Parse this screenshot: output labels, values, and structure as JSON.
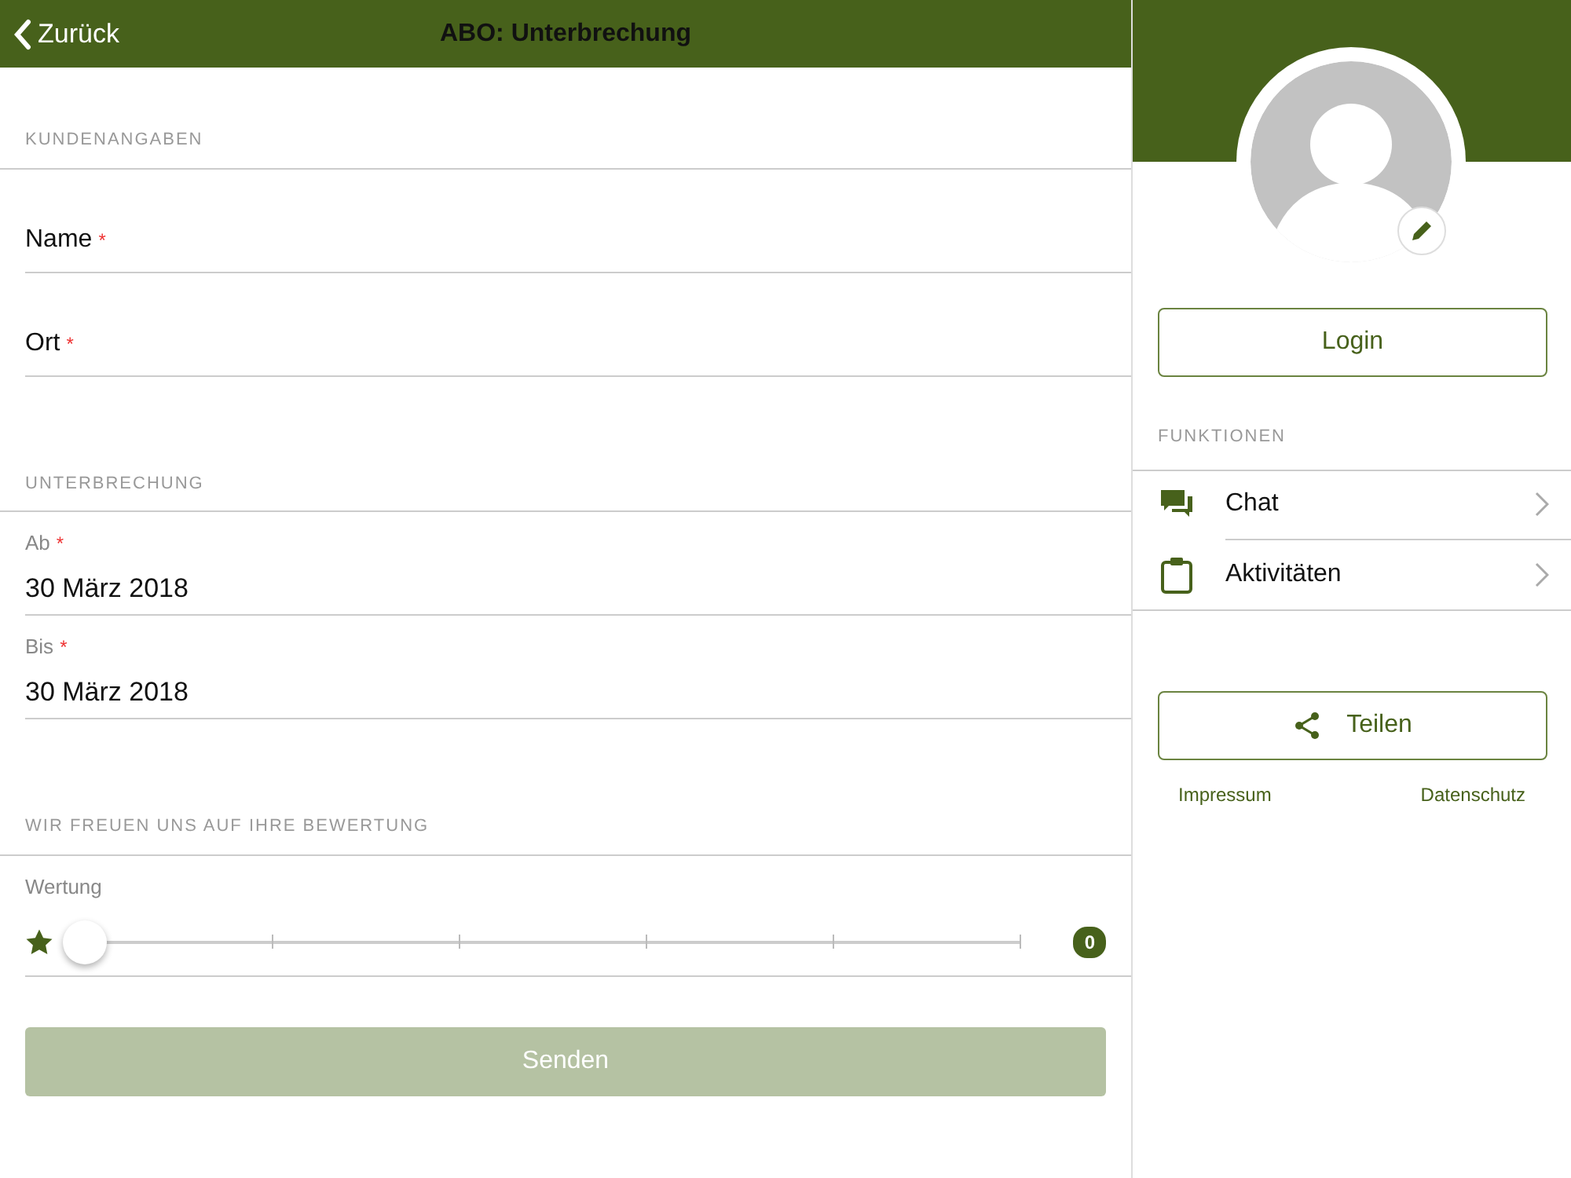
{
  "header": {
    "back": "Zurück",
    "title": "ABO: Unterbrechung"
  },
  "sections": [
    {
      "heading": "KUNDENANGABEN",
      "fields": [
        {
          "kind": "text",
          "label": "Name",
          "required_mark": "*"
        },
        {
          "kind": "text",
          "label": "Ort",
          "required_mark": "*"
        }
      ]
    },
    {
      "heading": "UNTERBRECHUNG",
      "fields": [
        {
          "kind": "date",
          "label": "Ab",
          "required_mark": "*",
          "value": "30 März 2018"
        },
        {
          "kind": "date",
          "label": "Bis",
          "required_mark": "*",
          "value": "30 März 2018"
        }
      ]
    },
    {
      "heading": "WIR FREUEN UNS AUF IHRE BEWERTUNG",
      "fields": [
        {
          "kind": "slider",
          "label": "Wertung",
          "level": 0,
          "reading": "0"
        }
      ]
    }
  ],
  "submit": {
    "label": "Senden",
    "disabled": true
  },
  "sidebar": {
    "login": "Login",
    "heading": "FUNKTIONEN",
    "items": [
      {
        "kind": "chat",
        "label": "Chat"
      },
      {
        "kind": "clipboard",
        "label": "Aktivitäten"
      }
    ],
    "share": "Teilen",
    "links": [
      "Impressum",
      "Datenschutz"
    ]
  }
}
